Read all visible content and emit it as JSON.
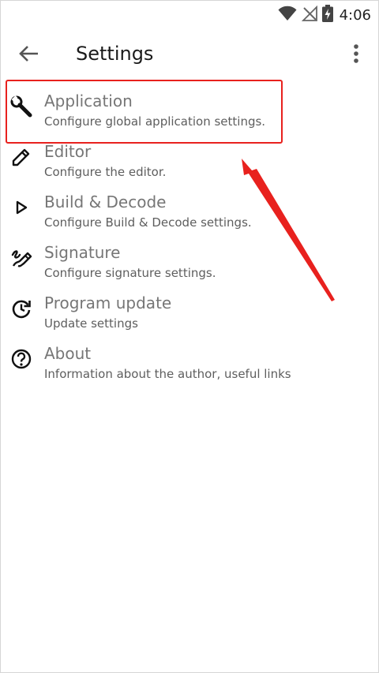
{
  "status_bar": {
    "time": "4:06",
    "icons": [
      "wifi-icon",
      "no-signal-icon",
      "battery-charging-icon"
    ]
  },
  "toolbar": {
    "title": "Settings",
    "back_icon": "arrow-back-icon",
    "menu_icon": "more-vertical-icon"
  },
  "items": [
    {
      "icon": "wrench-icon",
      "title": "Application",
      "summary": "Configure global application settings."
    },
    {
      "icon": "pencil-icon",
      "title": "Editor",
      "summary": "Configure the editor."
    },
    {
      "icon": "play-outline-icon",
      "title": "Build & Decode",
      "summary": "Configure Build & Decode settings."
    },
    {
      "icon": "signature-icon",
      "title": "Signature",
      "summary": "Configure signature settings."
    },
    {
      "icon": "update-icon",
      "title": "Program update",
      "summary": "Update settings"
    },
    {
      "icon": "help-circle-icon",
      "title": "About",
      "summary": "Information about the author, useful links"
    }
  ],
  "annotation": {
    "color": "#e8211e",
    "target": "Application"
  }
}
